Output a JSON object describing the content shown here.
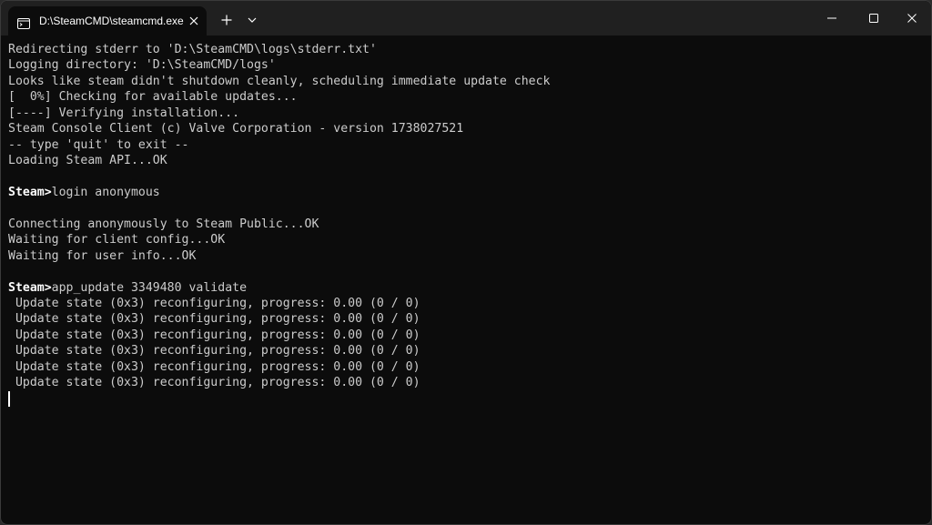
{
  "window": {
    "tab_title": "D:\\SteamCMD\\steamcmd.exe",
    "new_tab_symbol": "+",
    "tab_icon": "terminal-icon",
    "controls": [
      "minimize-icon",
      "maximize-icon",
      "close-icon"
    ]
  },
  "console": {
    "lines": [
      "Redirecting stderr to 'D:\\SteamCMD\\logs\\stderr.txt'",
      "Logging directory: 'D:\\SteamCMD/logs'",
      "Looks like steam didn't shutdown cleanly, scheduling immediate update check",
      "[  0%] Checking for available updates...",
      "[----] Verifying installation...",
      "Steam Console Client (c) Valve Corporation - version 1738027521",
      "-- type 'quit' to exit --",
      "Loading Steam API...OK",
      "",
      {
        "prompt": "Steam>",
        "command": "login anonymous"
      },
      "",
      "Connecting anonymously to Steam Public...OK",
      "Waiting for client config...OK",
      "Waiting for user info...OK",
      "",
      {
        "prompt": "Steam>",
        "command": "app_update 3349480 validate"
      },
      " Update state (0x3) reconfiguring, progress: 0.00 (0 / 0)",
      " Update state (0x3) reconfiguring, progress: 0.00 (0 / 0)",
      " Update state (0x3) reconfiguring, progress: 0.00 (0 / 0)",
      " Update state (0x3) reconfiguring, progress: 0.00 (0 / 0)",
      " Update state (0x3) reconfiguring, progress: 0.00 (0 / 0)",
      " Update state (0x3) reconfiguring, progress: 0.00 (0 / 0)"
    ]
  },
  "colors": {
    "console_bg": "#0c0c0c",
    "titlebar_bg": "#202020",
    "text": "#cccccc",
    "prompt": "#ffffff"
  }
}
